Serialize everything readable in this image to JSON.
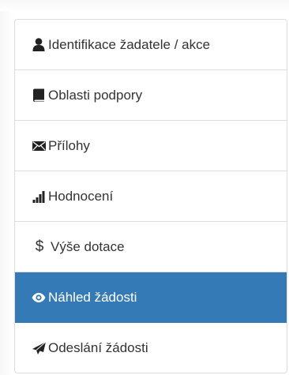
{
  "nav": {
    "items": [
      {
        "label": "Identifikace žadatele / akce",
        "icon": "user-icon",
        "active": false
      },
      {
        "label": "Oblasti podpory",
        "icon": "book-icon",
        "active": false
      },
      {
        "label": "Přílohy",
        "icon": "envelope-icon",
        "active": false
      },
      {
        "label": "Hodnocení",
        "icon": "signal-bars-icon",
        "active": false
      },
      {
        "label": "Výše dotace",
        "icon": "dollar-icon",
        "icon_glyph": "$",
        "active": false
      },
      {
        "label": "Náhled žádosti",
        "icon": "eye-icon",
        "active": true
      },
      {
        "label": "Odeslání žádosti",
        "icon": "send-icon",
        "active": false
      }
    ]
  },
  "colors": {
    "active_bg": "#337ab7",
    "border": "#dddddd",
    "text": "#333333"
  }
}
